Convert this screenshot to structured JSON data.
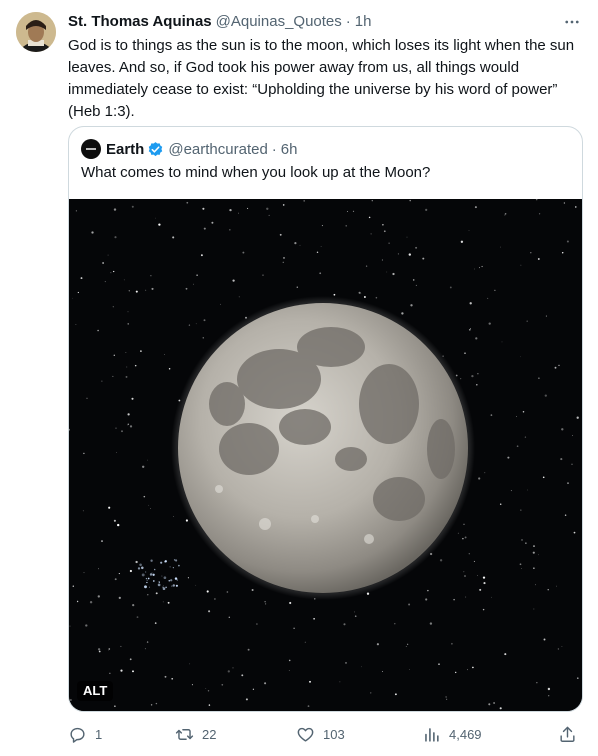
{
  "tweet": {
    "author_name": "St. Thomas Aquinas",
    "author_handle": "@Aquinas_Quotes",
    "separator": "·",
    "time": "1h",
    "text": "God is to things as the sun is to the moon, which loses its light when the sun leaves. And so, if God took his power away from us, all things would immediately cease to exist: “Upholding the universe by his word of power” (Heb 1:3)."
  },
  "quoted_tweet": {
    "author_name": "Earth",
    "author_handle": "@earthcurated",
    "separator": "·",
    "time": "6h",
    "text": "What comes to mind when you look up at the Moon?",
    "media_alt_badge": "ALT",
    "verified": true
  },
  "actions": {
    "reply_count": "1",
    "retweet_count": "22",
    "like_count": "103",
    "views_count": "4,469"
  },
  "icons": {
    "more": "more-dots-icon",
    "verified": "verified-badge-icon",
    "reply": "reply-icon",
    "retweet": "retweet-icon",
    "like": "heart-icon",
    "views": "views-bar-chart-icon",
    "share": "share-icon"
  },
  "colors": {
    "text_primary": "#0f1419",
    "text_secondary": "#536471",
    "border": "#cfd9de",
    "verified_blue": "#1d9bf0"
  }
}
